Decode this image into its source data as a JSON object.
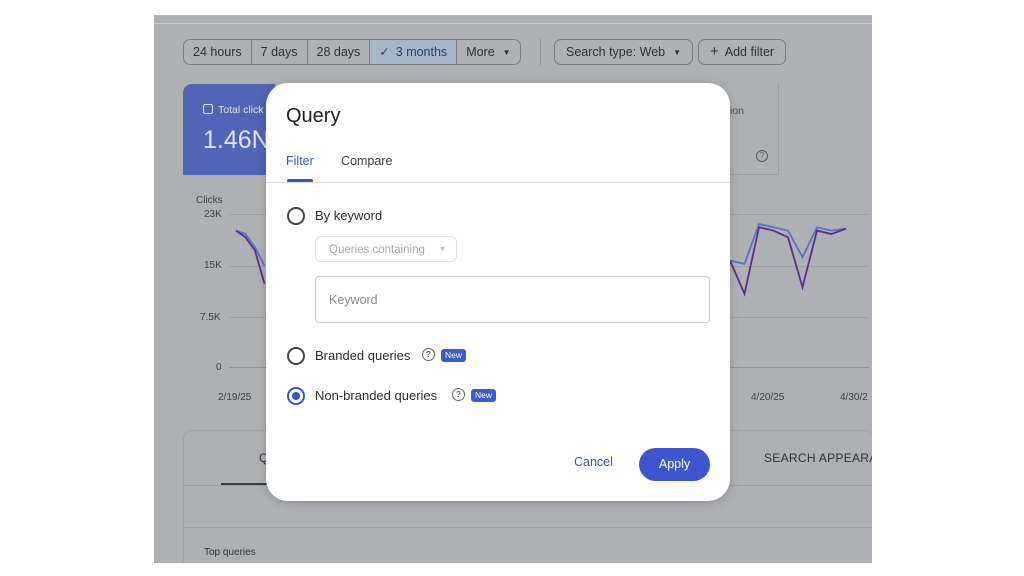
{
  "toolbar": {
    "date_ranges": [
      {
        "label": "24 hours",
        "selected": false
      },
      {
        "label": "7 days",
        "selected": false
      },
      {
        "label": "28 days",
        "selected": false
      },
      {
        "label": "3 months",
        "selected": true
      },
      {
        "label": "More",
        "selected": false
      }
    ],
    "search_type_label": "Search type: Web",
    "add_filter_label": "Add filter"
  },
  "metric_card": {
    "label": "Total click",
    "value": "1.46N"
  },
  "metric_card_right": {
    "label_fragment": "ion",
    "help_symbol": "?"
  },
  "chart_data": {
    "type": "line",
    "ylabel": "Clicks",
    "y_ticks": [
      "23K",
      "15K",
      "7.5K",
      "0"
    ],
    "ylim": [
      0,
      23000
    ],
    "x_ticks": [
      "2/19/25",
      "4/20/25",
      "4/30/2"
    ],
    "grid": true,
    "legend": "none",
    "colors": {
      "series_a": "#5d6fc4",
      "series_b": "#5a2f8f"
    },
    "visible_segments": {
      "left": {
        "series_a": [
          20500,
          20000,
          18000,
          15200
        ],
        "series_b": [
          20500,
          19500,
          17500,
          12500
        ]
      },
      "right": {
        "series_a": [
          16000,
          15500,
          21500,
          21000,
          20500,
          16500,
          21000,
          20500,
          20800
        ],
        "series_b": [
          16000,
          11000,
          21000,
          20500,
          19500,
          12000,
          20500,
          20000,
          20800
        ]
      }
    }
  },
  "table": {
    "tabs": [
      "Q",
      "SEARCH APPEARANC"
    ],
    "section_label": "Top queries"
  },
  "dialog": {
    "title": "Query",
    "tabs": [
      {
        "label": "Filter",
        "active": true
      },
      {
        "label": "Compare",
        "active": false
      }
    ],
    "options": {
      "by_keyword": {
        "label": "By keyword",
        "checked": false
      },
      "branded": {
        "label": "Branded queries",
        "badge": "New",
        "checked": false
      },
      "non_branded": {
        "label": "Non-branded queries",
        "badge": "New",
        "checked": true
      }
    },
    "queries_select": {
      "value": "Queries containing"
    },
    "keyword_input": {
      "placeholder": "Keyword",
      "value": ""
    },
    "help_symbol": "?",
    "cancel_label": "Cancel",
    "apply_label": "Apply"
  },
  "colors": {
    "accent": "#3655c9",
    "badge": "#3d5ad1",
    "scrim": "#aeb0b3",
    "metric_card": "#5264b6"
  }
}
